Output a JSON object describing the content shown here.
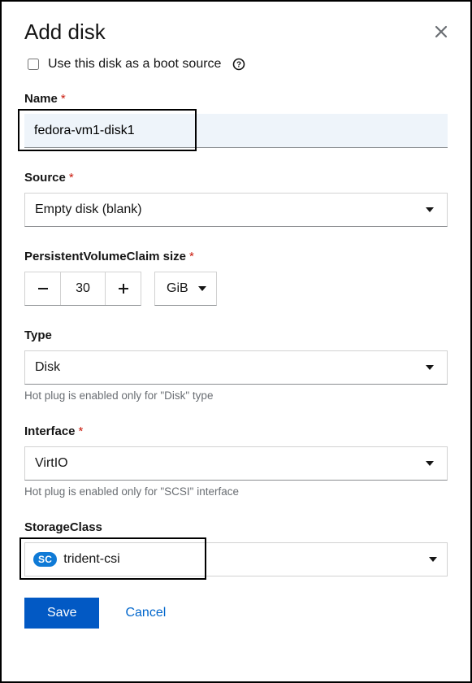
{
  "header": {
    "title": "Add disk"
  },
  "boot": {
    "label": "Use this disk as a boot source",
    "checked": false
  },
  "name": {
    "label": "Name",
    "value": "fedora-vm1-disk1"
  },
  "source": {
    "label": "Source",
    "value": "Empty disk (blank)"
  },
  "pvc": {
    "label": "PersistentVolumeClaim size",
    "value": "30",
    "unit": "GiB"
  },
  "type": {
    "label": "Type",
    "value": "Disk",
    "hint": "Hot plug is enabled only for \"Disk\" type"
  },
  "interface": {
    "label": "Interface",
    "value": "VirtIO",
    "hint": "Hot plug is enabled only for \"SCSI\" interface"
  },
  "storageclass": {
    "label": "StorageClass",
    "badge": "SC",
    "value": "trident-csi"
  },
  "actions": {
    "save": "Save",
    "cancel": "Cancel"
  }
}
